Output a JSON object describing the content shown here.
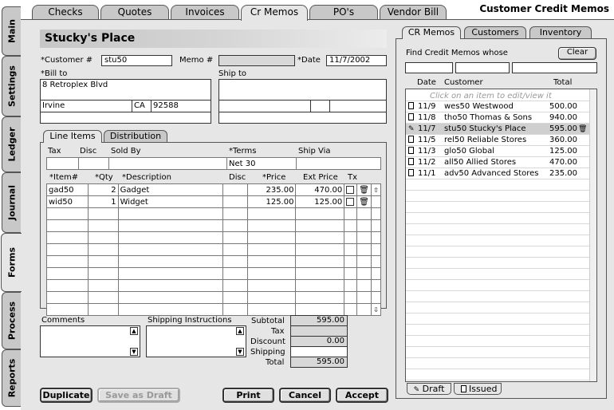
{
  "app_title": "Customer Credit Memos",
  "side_tabs": [
    "Main",
    "Settings",
    "Ledger",
    "Journal",
    "Forms",
    "Process",
    "Reports"
  ],
  "top_tabs": [
    "Checks",
    "Quotes",
    "Invoices",
    "Cr Memos",
    "PO's",
    "Vendor Bill"
  ],
  "header": {
    "customer_name": "Stucky's Place"
  },
  "form": {
    "customer_label": "*Customer #",
    "customer_value": "stu50",
    "memo_label": "Memo #",
    "memo_value": "",
    "date_label": "*Date",
    "date_value": "11/7/2002",
    "bill_to_label": "*Bill to",
    "bill_to_address": "8 Retroplex Blvd",
    "bill_to_city": "Irvine",
    "bill_to_state": "CA",
    "bill_to_zip": "92588",
    "ship_to_label": "Ship to"
  },
  "sub_tabs": [
    "Line Items",
    "Distribution"
  ],
  "terms_row": {
    "headers": [
      "Tax",
      "Disc",
      "Sold By",
      "*Terms",
      "Ship Via"
    ],
    "terms_value": "Net 30"
  },
  "line_items": {
    "headers": [
      "*Item#",
      "*Qty",
      "*Description",
      "Disc",
      "*Price",
      "Ext Price",
      "Tx"
    ],
    "rows": [
      {
        "item": "gad50",
        "qty": "2",
        "description": "Gadget",
        "disc": "",
        "price": "235.00",
        "ext": "470.00"
      },
      {
        "item": "wid50",
        "qty": "1",
        "description": "Widget",
        "disc": "",
        "price": "125.00",
        "ext": "125.00"
      }
    ]
  },
  "comments_label": "Comments",
  "shipping_label": "Shipping Instructions",
  "totals": {
    "subtotal_label": "Subtotal",
    "subtotal": "595.00",
    "tax_label": "Tax",
    "tax": "",
    "discount_label": "Discount",
    "discount": "0.00",
    "shipping_label": "Shipping",
    "shipping": "",
    "total_label": "Total",
    "total": "595.00"
  },
  "buttons": {
    "duplicate": "Duplicate",
    "save_draft": "Save as Draft",
    "print": "Print",
    "cancel": "Cancel",
    "accept": "Accept"
  },
  "right_panel": {
    "tabs": [
      "CR Memos",
      "Customers",
      "Inventory"
    ],
    "find_label": "Find Credit Memos whose",
    "clear_label": "Clear",
    "col_date": "Date",
    "col_customer": "Customer",
    "col_total": "Total",
    "hint": "Click on an item to edit/view it",
    "memos": [
      {
        "date": "11/9",
        "customer": "wes50 Westwood",
        "total": "500.00"
      },
      {
        "date": "11/8",
        "customer": "tho50 Thomas & Sons",
        "total": "940.00"
      },
      {
        "date": "11/7",
        "customer": "stu50 Stucky's Place",
        "total": "595.00"
      },
      {
        "date": "11/5",
        "customer": "rel50 Reliable Stores",
        "total": "360.00"
      },
      {
        "date": "11/3",
        "customer": "glo50 Global",
        "total": "125.00"
      },
      {
        "date": "11/2",
        "customer": "all50 Allied Stores",
        "total": "470.00"
      },
      {
        "date": "11/1",
        "customer": "adv50 Advanced Stores",
        "total": "235.00"
      }
    ],
    "bottom_tabs": [
      "Draft",
      "Issued"
    ]
  }
}
